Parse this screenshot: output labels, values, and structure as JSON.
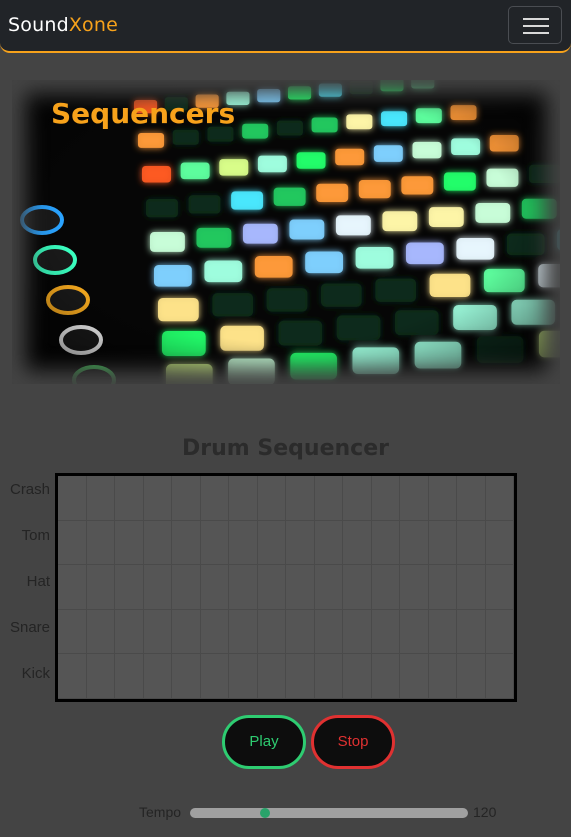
{
  "navbar": {
    "brand_part1": "Sound",
    "brand_part2": "Xone",
    "menu_icon": "hamburger-menu-icon",
    "accent_color": "#f7a21b"
  },
  "hero": {
    "title": "Sequencers",
    "image": "glowing-launchpad-pads-photo"
  },
  "sequencer": {
    "title": "Drum Sequencer",
    "rows": [
      "Crash",
      "Tom",
      "Hat",
      "Snare",
      "Kick"
    ],
    "steps": 16,
    "active_steps": []
  },
  "controls": {
    "play_label": "Play",
    "stop_label": "Stop",
    "play_color": "#2ecc71",
    "stop_color": "#e03131"
  },
  "tempo": {
    "label": "Tempo",
    "value": "120",
    "position_fraction": 0.25
  }
}
